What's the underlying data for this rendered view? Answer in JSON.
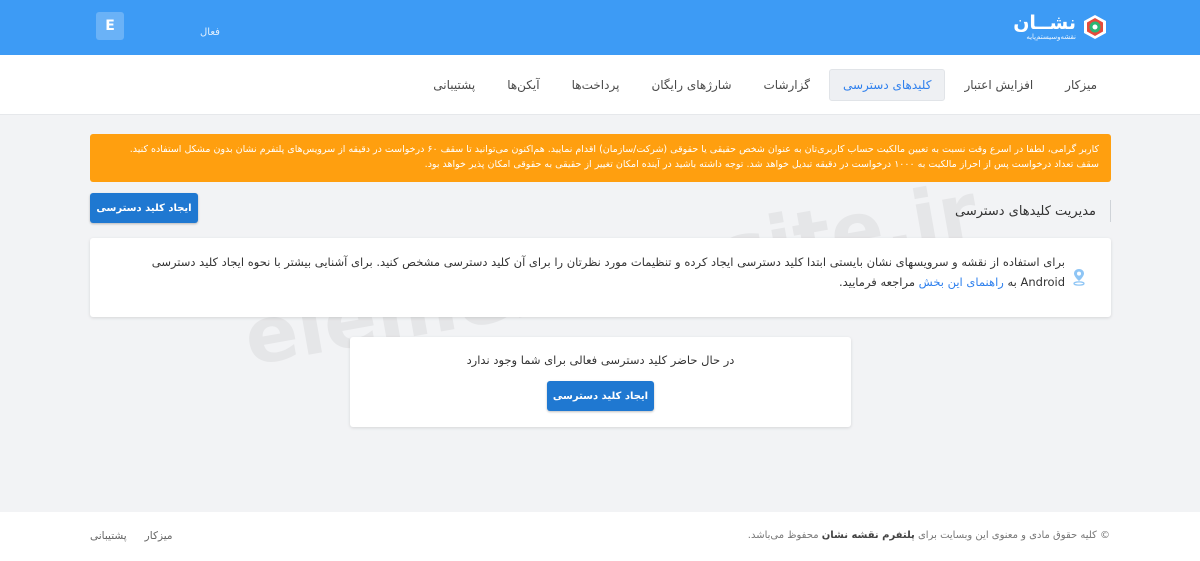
{
  "header": {
    "avatar_letter": "E",
    "status": "فعال",
    "logo_name": "نشــان",
    "logo_tagline": "نقشه‌وسیستم‌پایه"
  },
  "nav": {
    "items": [
      {
        "label": "میزکار",
        "active": false
      },
      {
        "label": "افزایش اعتبار",
        "active": false
      },
      {
        "label": "کلیدهای دسترسی",
        "active": true
      },
      {
        "label": "گزارشات",
        "active": false
      },
      {
        "label": "شارژهای رایگان",
        "active": false
      },
      {
        "label": "پرداخت‌ها",
        "active": false
      },
      {
        "label": "آیکن‌ها",
        "active": false
      },
      {
        "label": "پشتیبانی",
        "active": false
      }
    ]
  },
  "alert": {
    "line1": "کاربر گرامی، لطفا در اسرع وقت نسبت به تعیین مالکیت حساب کاربری‌تان به عنوان شخص حقیقی یا حقوقی (شرکت/سازمان) اقدام نمایید. هم‌اکنون می‌توانید تا سقف ۶۰ درخواست در دقیقه از سرویس‌های پلتفرم نشان بدون مشکل استفاده کنید.",
    "line2": "سقف تعداد درخواست پس از احراز مالکیت به ۱۰۰۰ درخواست در دقیقه تبدیل خواهد شد. توجه داشته باشید در آینده امکان تغییر از حقیقی به حقوقی امکان پذیر خواهد بود."
  },
  "section": {
    "title": "مدیریت کلیدهای دسترسی",
    "create_button": "ایجاد کلید دسترسی"
  },
  "info": {
    "text_main": "برای استفاده از نقشه و سرویسهای نشان بایستی ابتدا کلید دسترسی ایجاد کرده و تنظیمات مورد نظرتان را برای آن کلید دسترسی مشخص کنید. برای آشنایی بیشتر با نحوه ایجاد کلید دسترسی Android به",
    "link": "راهنمای این بخش",
    "text_end": "مراجعه فرمایید."
  },
  "empty_state": {
    "message": "در حال حاضر کلید دسترسی فعالی برای شما وجود ندارد",
    "button": "ایجاد کلید دسترسی"
  },
  "watermark": "elementor-site.ir",
  "footer": {
    "copyright_prefix": "© کلیه حقوق مادی و معنوی این وبسایت برای",
    "copyright_brand": "پلتفرم نقشه نشان",
    "copyright_suffix": "محفوظ می‌باشد.",
    "links": [
      "میزکار",
      "پشتیبانی"
    ]
  },
  "colors": {
    "header_bg": "#3d9bf5",
    "alert_bg": "#ff9f0f",
    "primary_button": "#1f78d1",
    "link": "#2f80ed"
  },
  "icons": [
    "logo-mark-icon",
    "location-info-icon"
  ]
}
